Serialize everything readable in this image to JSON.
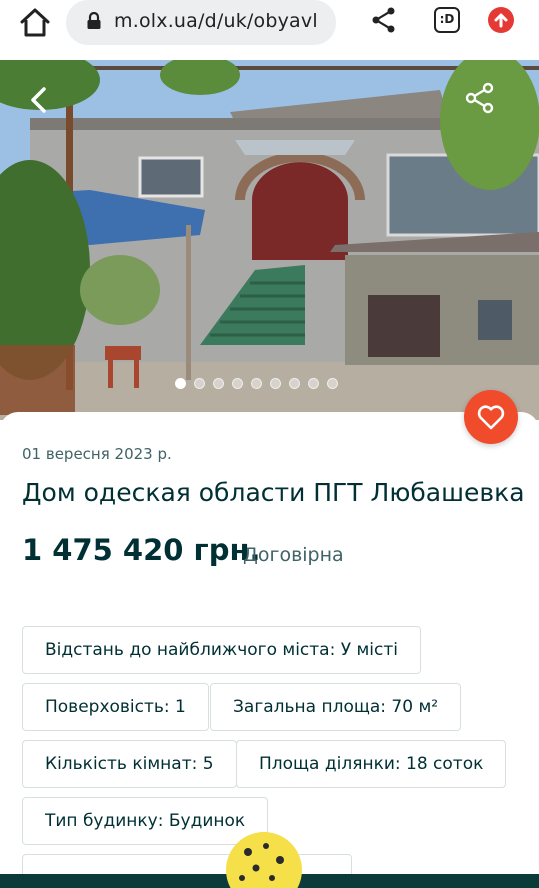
{
  "browser": {
    "url": "m.olx.ua/d/uk/obyavl",
    "tab_count": ":D",
    "icons": [
      "home-icon",
      "lock-icon",
      "share-icon",
      "tabs-icon",
      "upload-icon"
    ]
  },
  "gallery": {
    "photo_count": 9,
    "active_index": 0,
    "icons": [
      "back-arrow-icon",
      "share-icon",
      "heart-icon"
    ]
  },
  "listing": {
    "date": "01 вересня 2023 р.",
    "title": "Дом одеская области ПГТ Любашевка",
    "price": "1 475 420 грн.",
    "negotiable": "Договірна"
  },
  "params": [
    {
      "label": "Відстань до найближчого міста: У місті"
    },
    {
      "label": "Поверховість: 1"
    },
    {
      "label": "Загальна площа: 70 м²"
    },
    {
      "label": "Кількість кімнат: 5"
    },
    {
      "label": "Площа ділянки: 18 соток"
    },
    {
      "label": "Тип будинку: Будинок"
    }
  ],
  "colors": {
    "accent_heart": "#f04c2c",
    "text_dark": "#002f34",
    "text_muted": "#406367",
    "chip_border": "#d8dfe0"
  }
}
